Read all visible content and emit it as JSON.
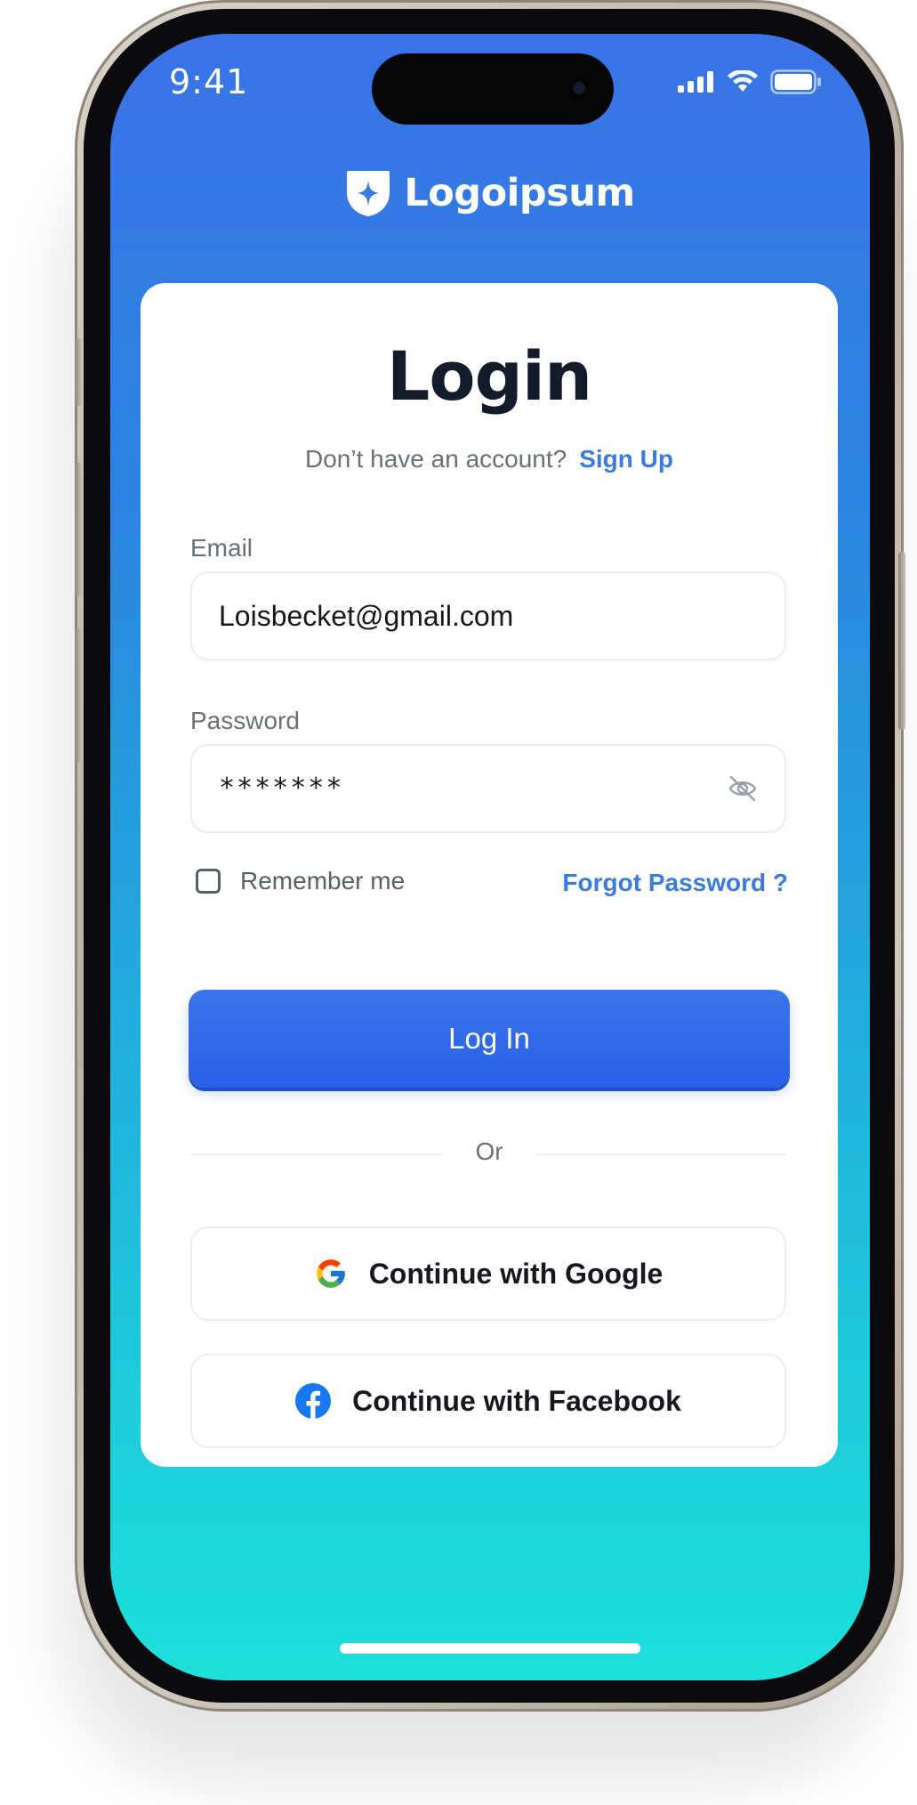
{
  "status_bar": {
    "time": "9:41"
  },
  "brand": {
    "name": "Logoipsum",
    "icon": "shield-star-icon"
  },
  "login": {
    "title": "Login",
    "signup_prompt": "Don’t have an account?",
    "signup_link": "Sign Up",
    "email_label": "Email",
    "email_value": "Loisbecket@gmail.com",
    "password_label": "Password",
    "password_value": "*******",
    "password_toggle_icon": "eye-off-icon",
    "remember_label": "Remember me",
    "remember_checked": false,
    "forgot_link": "Forgot Password ?",
    "submit_label": "Log In",
    "divider_text": "Or",
    "google_label": "Continue with Google",
    "facebook_label": "Continue with Facebook"
  },
  "colors": {
    "accent": "#3b7be0",
    "primary_button": "#2760e6",
    "gradient_top": "#3a73e6",
    "gradient_bottom": "#1de0da",
    "title_text": "#121a2c"
  }
}
